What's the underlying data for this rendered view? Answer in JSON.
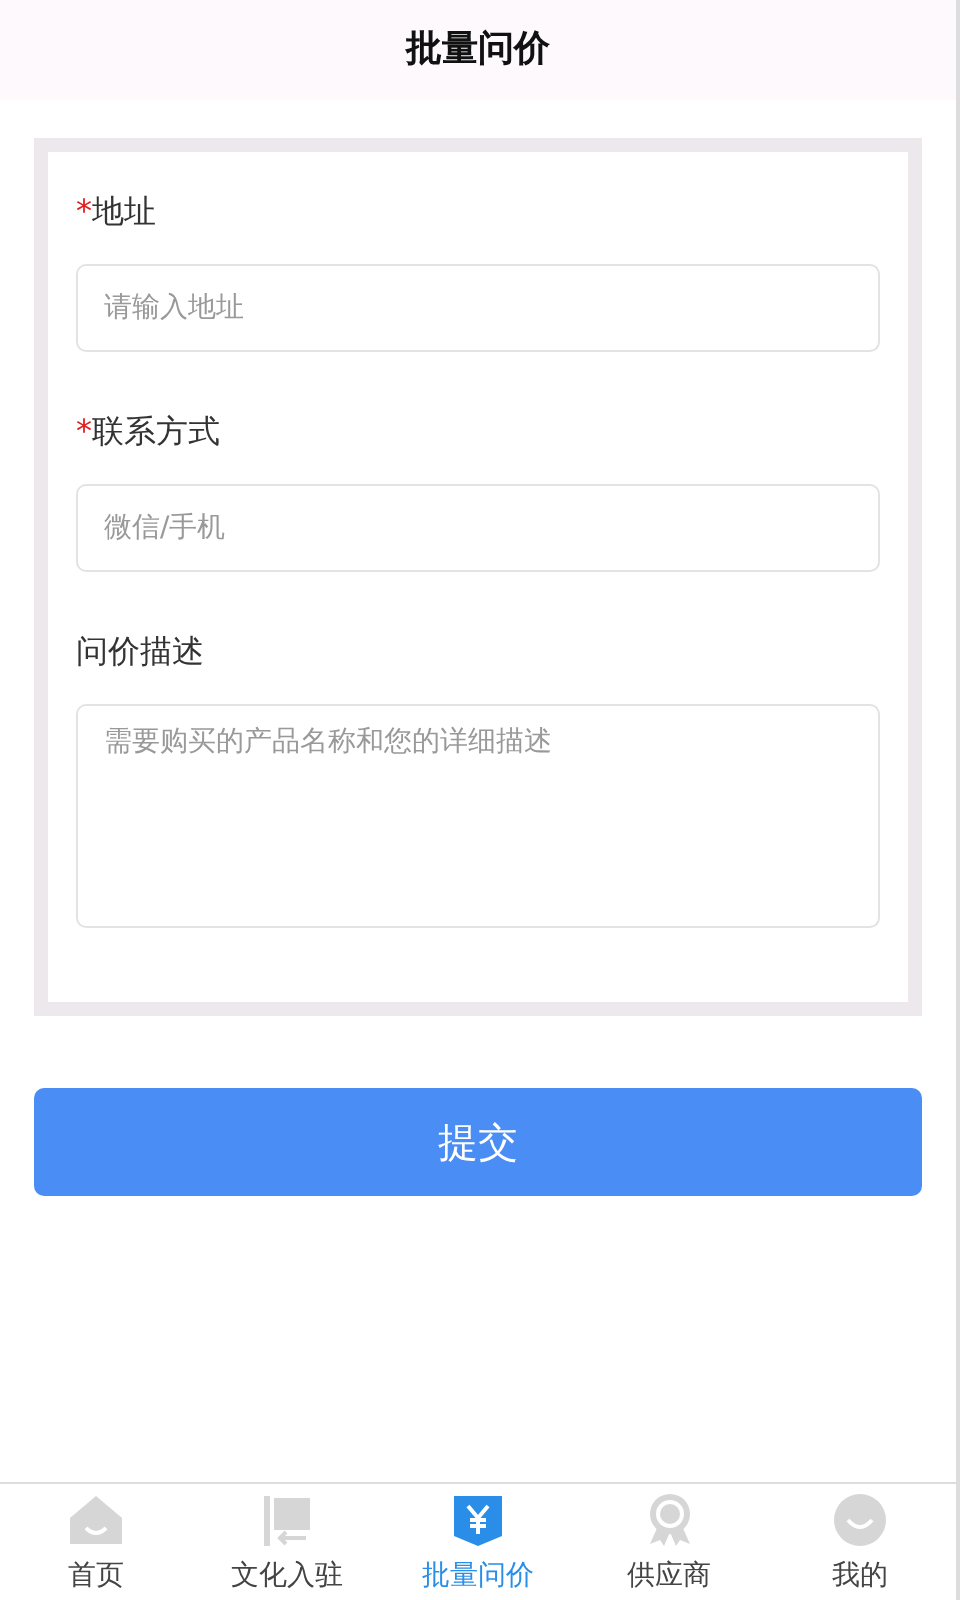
{
  "header": {
    "title": "批量问价"
  },
  "form": {
    "fields": [
      {
        "label": "地址",
        "mark": "*",
        "kind": "input",
        "placeholder": "请输入地址"
      },
      {
        "label": "联系方式",
        "mark": "*",
        "kind": "input",
        "placeholder": "微信/手机"
      },
      {
        "label": "问价描述",
        "kind": "textarea",
        "placeholder": "需要购买的产品名称和您的详细描述"
      }
    ]
  },
  "submit_button": "提交",
  "tab_bar": [
    {
      "label": "首页",
      "selected": false
    },
    {
      "label": "文化入驻",
      "selected": false
    },
    {
      "label": "批量问价",
      "selected": true
    },
    {
      "label": "供应商",
      "selected": false
    },
    {
      "label": "我的",
      "selected": false
    }
  ]
}
